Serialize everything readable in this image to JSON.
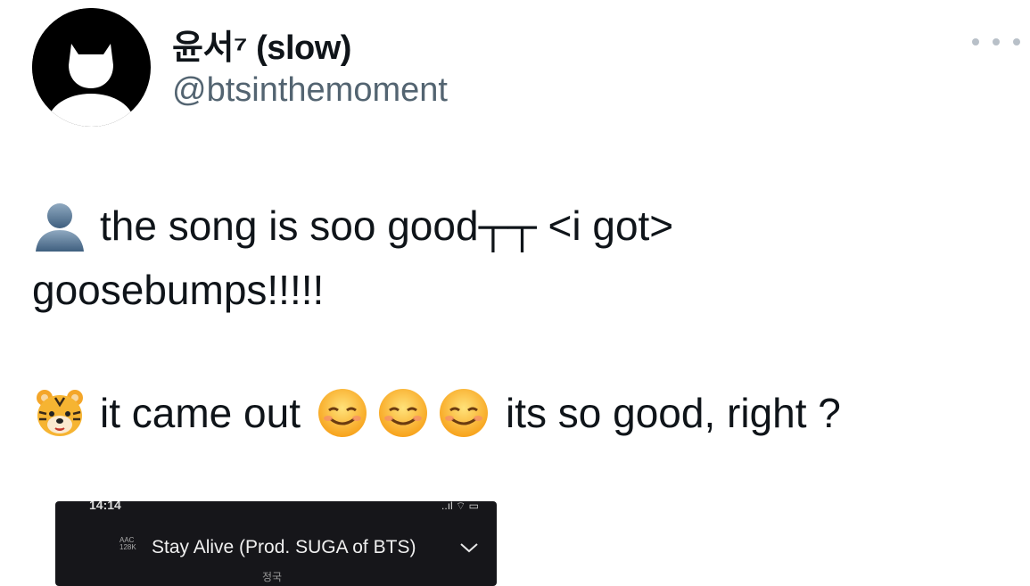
{
  "header": {
    "display_name": "윤서⁷ (slow)",
    "handle": "@btsinthemoment"
  },
  "icons": {
    "avatar": "cat-silhouette-avatar",
    "more": "more-options-icon",
    "line1_emoji": "bust-in-silhouette-emoji",
    "line3_emoji": "tiger-face-emoji",
    "smile_emoji": "smiling-face-emoji",
    "chevron": "chevron-down-icon"
  },
  "tweet": {
    "line1_text": "the song is soo good┬┬ <i got>",
    "line2_text": "goosebumps!!!!!",
    "line3_text": "it came out",
    "line3_suffix": "its so good, right ?"
  },
  "media": {
    "status_time": "14:14",
    "status_icons": "..ıl ⌔ ▭",
    "codec_line1": "AAC",
    "codec_line2": "128K",
    "song_title": "Stay Alive (Prod. SUGA of BTS)",
    "artist": "정국"
  },
  "colors": {
    "text_primary": "#0f1419",
    "text_secondary": "#536471",
    "media_bg": "#16161a"
  }
}
